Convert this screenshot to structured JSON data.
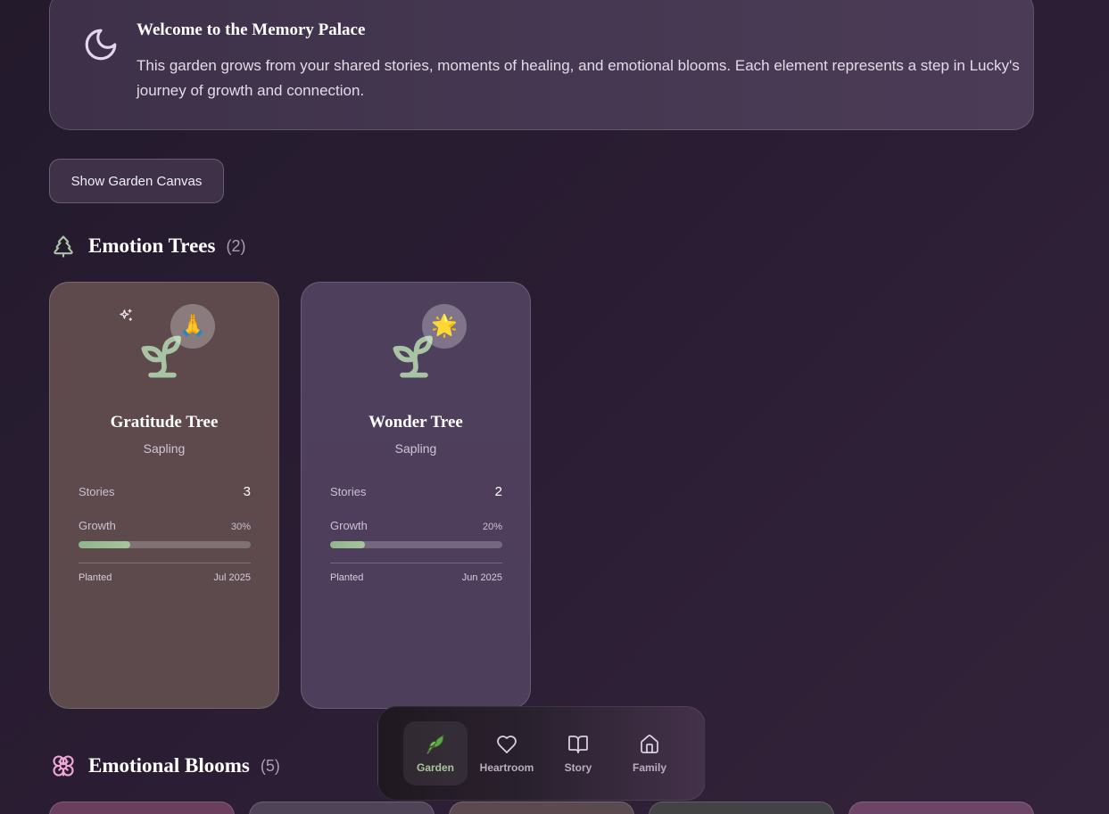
{
  "welcome": {
    "title": "Welcome to the Memory Palace",
    "text": "This garden grows from your shared stories, moments of healing, and emotional blooms. Each element represents a step in Lucky's journey of growth and connection.",
    "icon": "moon-icon"
  },
  "canvas_button": {
    "label": "Show Garden Canvas"
  },
  "trees_section": {
    "title": "Emotion Trees",
    "count": "(2)",
    "icon": "tree-icon",
    "trees": [
      {
        "name": "Gratitude Tree",
        "stage": "Sapling",
        "badge_emoji": "🙏",
        "stories_label": "Stories",
        "stories": "3",
        "growth_label": "Growth",
        "growth": "30%",
        "growth_value": 0.3,
        "planted_label": "Planted",
        "planted": "Jul 2025",
        "has_sparkle": true
      },
      {
        "name": "Wonder Tree",
        "stage": "Sapling",
        "badge_emoji": "🌟",
        "stories_label": "Stories",
        "stories": "2",
        "growth_label": "Growth",
        "growth": "20%",
        "growth_value": 0.2,
        "planted_label": "Planted",
        "planted": "Jun 2025",
        "has_sparkle": false
      }
    ]
  },
  "blooms_section": {
    "title": "Emotional Blooms",
    "count": "(5)",
    "icon": "flower-icon",
    "card_colors": [
      "#6a3f5e",
      "#4f4358",
      "#5a4a4f",
      "#434245",
      "#6b4466"
    ]
  },
  "nav": {
    "items": [
      {
        "label": "Garden",
        "icon": "leaf-icon",
        "active": true
      },
      {
        "label": "Heartroom",
        "icon": "heart-icon",
        "active": false
      },
      {
        "label": "Story",
        "icon": "book-icon",
        "active": false
      },
      {
        "label": "Family",
        "icon": "home-icon",
        "active": false
      }
    ]
  },
  "colors": {
    "accent_green": "#a6c69c",
    "sprout_green": "#a9c4a4",
    "bloom_pink": "#f0a8d6"
  }
}
